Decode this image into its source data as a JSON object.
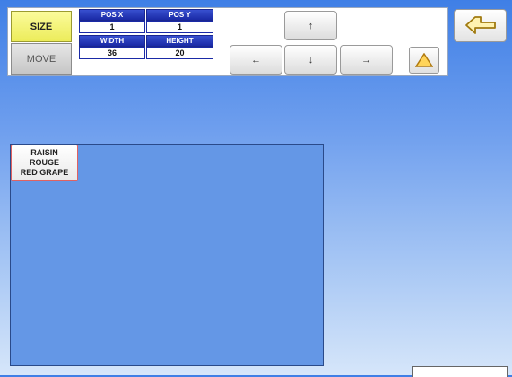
{
  "mode_buttons": {
    "size": "SIZE",
    "move": "MOVE"
  },
  "fields": {
    "pos_x": {
      "label": "POS X",
      "value": "1"
    },
    "pos_y": {
      "label": "POS Y",
      "value": "1"
    },
    "width": {
      "label": "WIDTH",
      "value": "36"
    },
    "height": {
      "label": "HEIGHT",
      "value": "20"
    }
  },
  "arrows": {
    "up": "↑",
    "left": "←",
    "down": "↓",
    "right": "→"
  },
  "icons": {
    "warning": "warning-triangle-icon",
    "back": "return-arrow-icon"
  },
  "item": {
    "lines": [
      "RAISIN",
      "ROUGE",
      "RED GRAPE"
    ]
  },
  "colors": {
    "accent_yellow": "#ecec5a",
    "field_header": "#1a2aa6",
    "canvas": "#6497e6",
    "tile_border": "#e06262"
  }
}
